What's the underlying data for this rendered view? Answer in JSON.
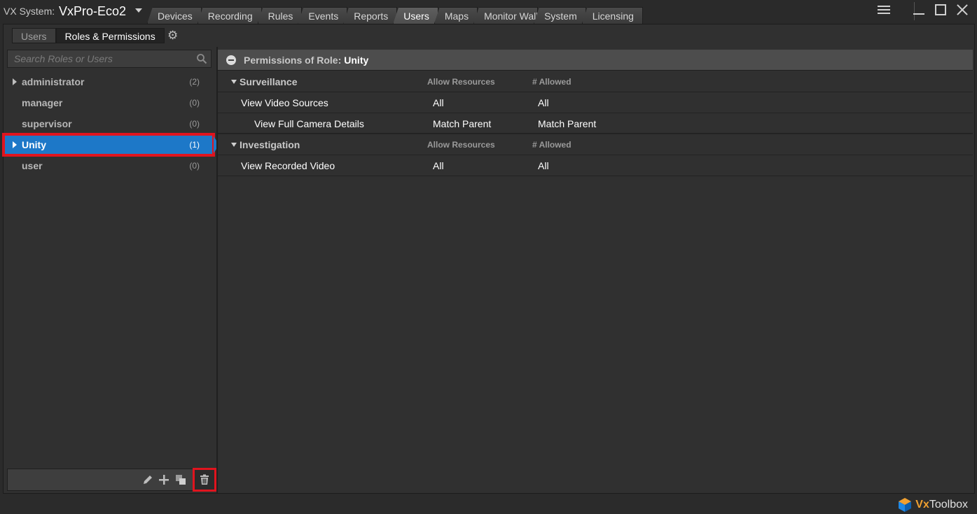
{
  "window": {
    "system_label": "VX System:",
    "system_name": "VxPro-Eco2"
  },
  "tabs": [
    {
      "label": "Devices"
    },
    {
      "label": "Recording"
    },
    {
      "label": "Rules"
    },
    {
      "label": "Events"
    },
    {
      "label": "Reports"
    },
    {
      "label": "Users",
      "active": true
    },
    {
      "label": "Maps"
    },
    {
      "label": "Monitor Walls"
    },
    {
      "label": "System"
    },
    {
      "label": "Licensing"
    }
  ],
  "subtabs": [
    {
      "label": "Users"
    },
    {
      "label": "Roles & Permissions",
      "active": true
    }
  ],
  "search": {
    "placeholder": "Search Roles or Users",
    "value": ""
  },
  "roles": [
    {
      "name": "administrator",
      "count": "(2)",
      "expandable": true
    },
    {
      "name": "manager",
      "count": "(0)"
    },
    {
      "name": "supervisor",
      "count": "(0)"
    },
    {
      "name": "Unity",
      "count": "(1)",
      "expandable": true,
      "selected": true
    },
    {
      "name": "user",
      "count": "(0)"
    }
  ],
  "permissions": {
    "title_label": "Permissions of Role:",
    "role_name": "Unity",
    "col_allow": "Allow Resources",
    "col_allowed": "# Allowed",
    "sections": [
      {
        "name": "Surveillance",
        "rows": [
          {
            "name": "View Video Sources",
            "allow": "All",
            "allowed": "All",
            "indent": 1
          },
          {
            "name": "View Full Camera Details",
            "allow": "Match Parent",
            "allowed": "Match Parent",
            "indent": 2
          }
        ]
      },
      {
        "name": "Investigation",
        "rows": [
          {
            "name": "View Recorded Video",
            "allow": "All",
            "allowed": "All",
            "indent": 1
          }
        ]
      }
    ]
  },
  "brand": {
    "prefix": "Vx",
    "suffix": "Toolbox"
  },
  "colors": {
    "selection": "#1d78c8",
    "highlight_box": "#e0141e",
    "brand_accent": "#f0a030"
  }
}
